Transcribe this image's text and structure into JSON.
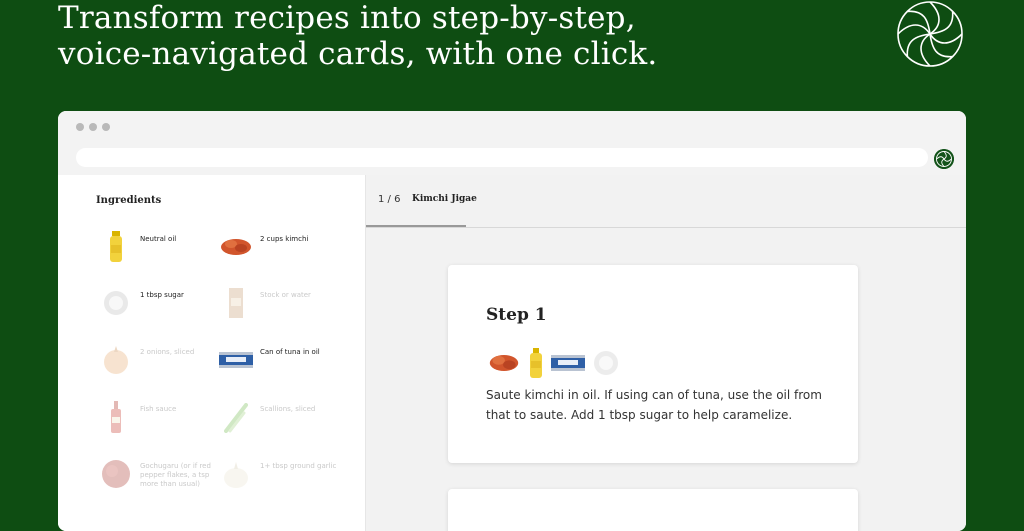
{
  "headline": {
    "line1": "Transform recipes into step-by-step,",
    "line2": "voice-navigated cards, with one click."
  },
  "logo_icon": "swirl-logo-icon",
  "browser": {
    "url": "",
    "extension_icon": "swirl-extension-icon"
  },
  "sidebar": {
    "title": "Ingredients",
    "items": [
      {
        "label": "Neutral oil",
        "icon": "oil-bottle-icon",
        "faded": false
      },
      {
        "label": "2 cups kimchi",
        "icon": "kimchi-icon",
        "faded": false
      },
      {
        "label": "1 tbsp sugar",
        "icon": "sugar-icon",
        "faded": false
      },
      {
        "label": "Stock or water",
        "icon": "stock-carton-icon",
        "faded": true
      },
      {
        "label": "2 onions, sliced",
        "icon": "onion-icon",
        "faded": true
      },
      {
        "label": "Can of tuna in oil",
        "icon": "tuna-can-icon",
        "faded": false
      },
      {
        "label": "Fish sauce",
        "icon": "fish-sauce-icon",
        "faded": true
      },
      {
        "label": "Scallions, sliced",
        "icon": "scallion-icon",
        "faded": true
      },
      {
        "label": "Gochugaru (or if red pepper flakes, a tsp more than usual)",
        "icon": "gochugaru-icon",
        "faded": true
      },
      {
        "label": "1+ tbsp ground garlic",
        "icon": "garlic-icon",
        "faded": true
      }
    ]
  },
  "main": {
    "counter": "1 / 6",
    "recipe_title": "Kimchi Jigae",
    "progress_fraction": 0.1667,
    "step": {
      "title": "Step 1",
      "icons": [
        "kimchi-icon",
        "oil-bottle-icon",
        "tuna-can-icon",
        "sugar-icon"
      ],
      "text": "Saute kimchi in oil. If using can of tuna, use the oil from that to saute. Add 1 tbsp sugar to help caramelize."
    }
  },
  "colors": {
    "brand_green": "#0e4d12",
    "accent_dark": "#13531a"
  }
}
